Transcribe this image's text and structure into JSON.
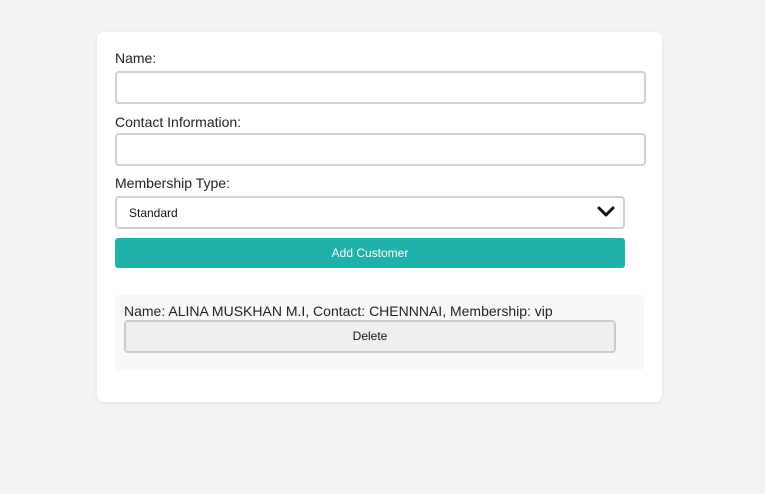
{
  "form": {
    "name_label": "Name:",
    "name_value": "",
    "contact_label": "Contact Information:",
    "contact_value": "",
    "membership_label": "Membership Type:",
    "membership_selected": "Standard",
    "add_button_label": "Add Customer"
  },
  "customers": [
    {
      "summary": "Name: ALINA MUSKHAN M.I, Contact: CHENNNAI, Membership: vip",
      "delete_label": "Delete"
    }
  ],
  "colors": {
    "accent": "#20b2aa",
    "page_background": "#f2f3f5"
  },
  "icons": {
    "select_arrow": "chevron-down-icon"
  }
}
